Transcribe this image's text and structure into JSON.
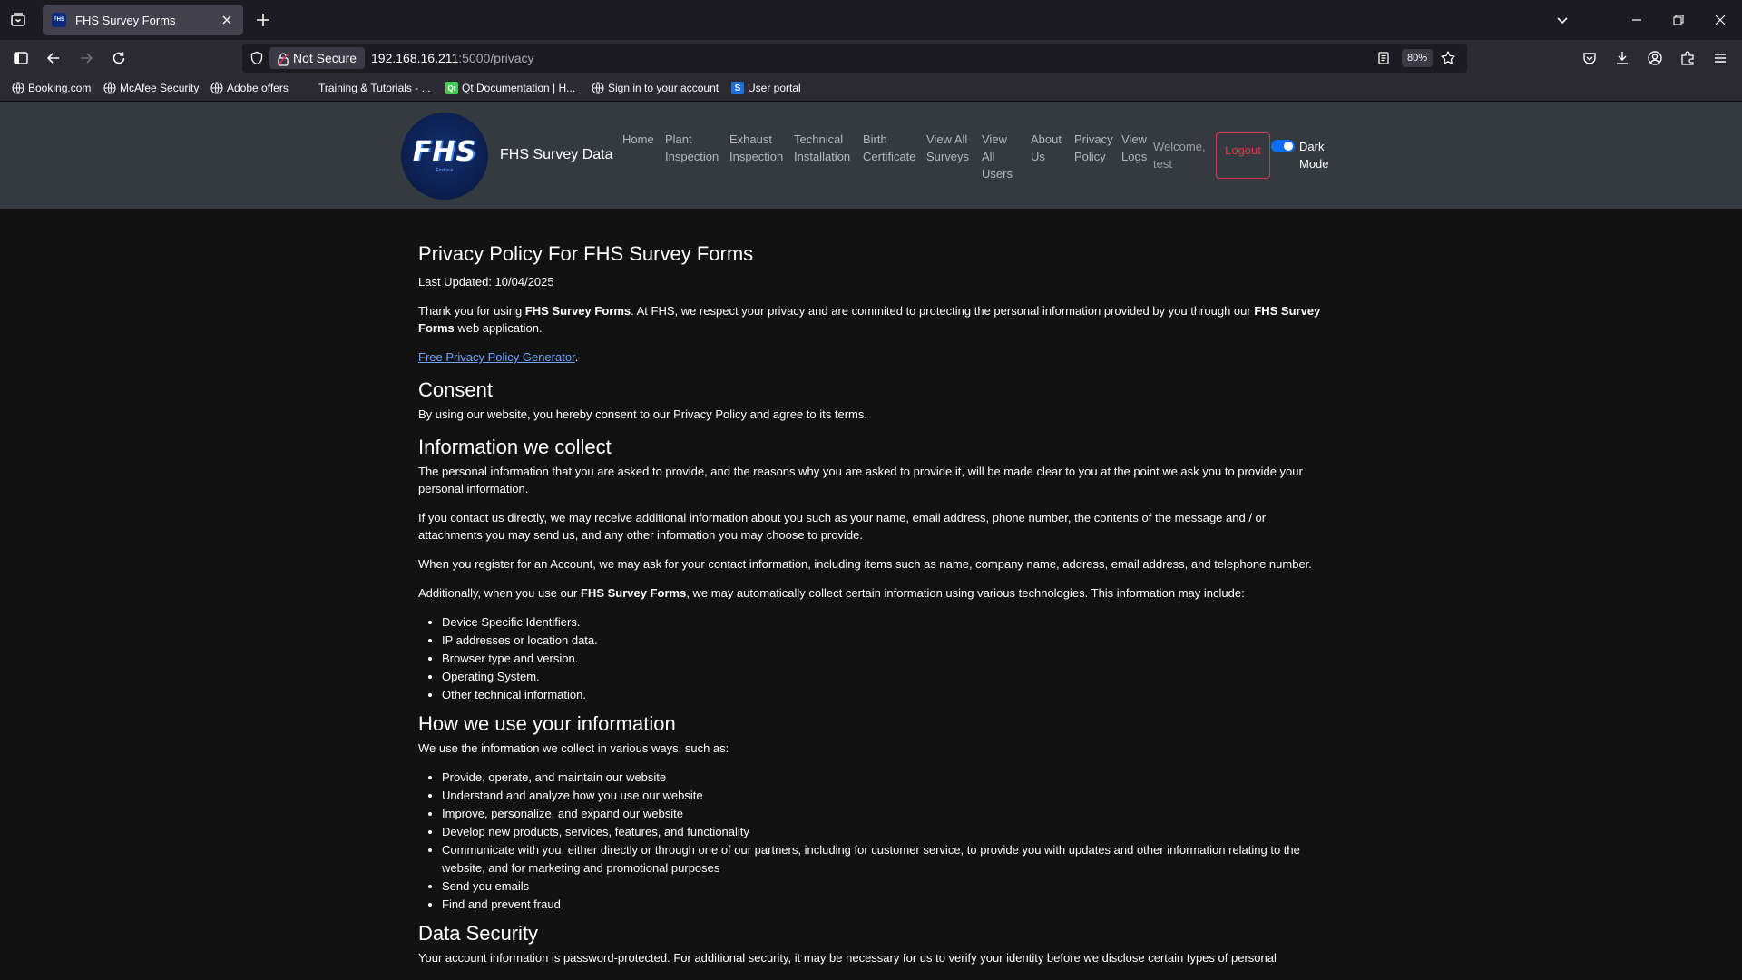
{
  "browser": {
    "tab_title": "FHS Survey Forms",
    "favicon_text": "FHS",
    "not_secure_label": "Not Secure",
    "url_host": "192.168.16.211",
    "url_path": ":5000/privacy",
    "zoom": "80%"
  },
  "bookmarks": [
    {
      "label": "Booking.com",
      "icon": "globe-icon"
    },
    {
      "label": "McAfee Security",
      "icon": "globe-icon"
    },
    {
      "label": "Adobe offers",
      "icon": "globe-icon"
    },
    {
      "label": "Training & Tutorials - ...",
      "icon": "none"
    },
    {
      "label": "Qt Documentation | H...",
      "icon": "qt-icon"
    },
    {
      "label": "Sign in to your account",
      "icon": "globe-icon"
    },
    {
      "label": "User portal",
      "icon": "portal-icon"
    }
  ],
  "header": {
    "logo_text": "FHS",
    "logo_subtext": "Fastlace",
    "brand": "FHS Survey Data",
    "nav": [
      {
        "line1": "Home",
        "line2": "",
        "line3": ""
      },
      {
        "line1": "Plant",
        "line2": "Inspection",
        "line3": ""
      },
      {
        "line1": "Exhaust",
        "line2": "Inspection",
        "line3": ""
      },
      {
        "line1": "Technical",
        "line2": "Installation",
        "line3": ""
      },
      {
        "line1": "Birth",
        "line2": "Certificate",
        "line3": ""
      },
      {
        "line1": "View All",
        "line2": "Surveys",
        "line3": ""
      },
      {
        "line1": "View",
        "line2": "All",
        "line3": "Users"
      },
      {
        "line1": "About",
        "line2": "Us",
        "line3": ""
      },
      {
        "line1": "Privacy",
        "line2": "Policy",
        "line3": ""
      },
      {
        "line1": "View",
        "line2": "Logs",
        "line3": ""
      }
    ],
    "welcome_line1": "Welcome,",
    "welcome_line2": "test",
    "logout": "Logout",
    "dark_mode_line1": "Dark",
    "dark_mode_line2": "Mode",
    "dark_mode_on": true
  },
  "policy": {
    "title": "Privacy Policy For FHS Survey Forms",
    "last_updated": "Last Updated: 10/04/2025",
    "intro": {
      "t1": "Thank you for using ",
      "b1": "FHS Survey Forms",
      "t2": ". At FHS, we respect your privacy and are commited to protecting the personal information provided by you through our ",
      "b2": "FHS Survey Forms",
      "t3": " web application."
    },
    "generator_link": "Free Privacy Policy Generator",
    "generator_suffix": ".",
    "consent_heading": "Consent",
    "consent_text": "By using our website, you hereby consent to our Privacy Policy and agree to its terms.",
    "collect_heading": "Information we collect",
    "collect_p1": "The personal information that you are asked to provide, and the reasons why you are asked to provide it, will be made clear to you at the point we ask you to provide your personal information.",
    "collect_p2": "If you contact us directly, we may receive additional information about you such as your name, email address, phone number, the contents of the message and / or attachments you may send us, and any other information you may choose to provide.",
    "collect_p3": "When you register for an Account, we may ask for your contact information, including items such as name, company name, address, email address, and telephone number.",
    "collect_p4": {
      "t1": "Additionally, when you use our ",
      "b1": "FHS Survey Forms",
      "t2": ", we may automatically collect certain information using various technologies. This information may include:"
    },
    "collect_list": [
      "Device Specific Identifiers.",
      "IP addresses or location data.",
      "Browser type and version.",
      "Operating System.",
      "Other technical information."
    ],
    "use_heading": "How we use your information",
    "use_intro": "We use the information we collect in various ways, such as:",
    "use_list": [
      "Provide, operate, and maintain our website",
      "Understand and analyze how you use our website",
      "Improve, personalize, and expand our website",
      "Develop new products, services, features, and functionality",
      "Communicate with you, either directly or through one of our partners, including for customer service, to provide you with updates and other information relating to the website, and for marketing and promotional purposes",
      "Send you emails",
      "Find and prevent fraud"
    ],
    "security_heading": "Data Security",
    "security_text": "Your account information is password-protected. For additional security, it may be necessary for us to verify your identity before we disclose certain types of personal"
  }
}
